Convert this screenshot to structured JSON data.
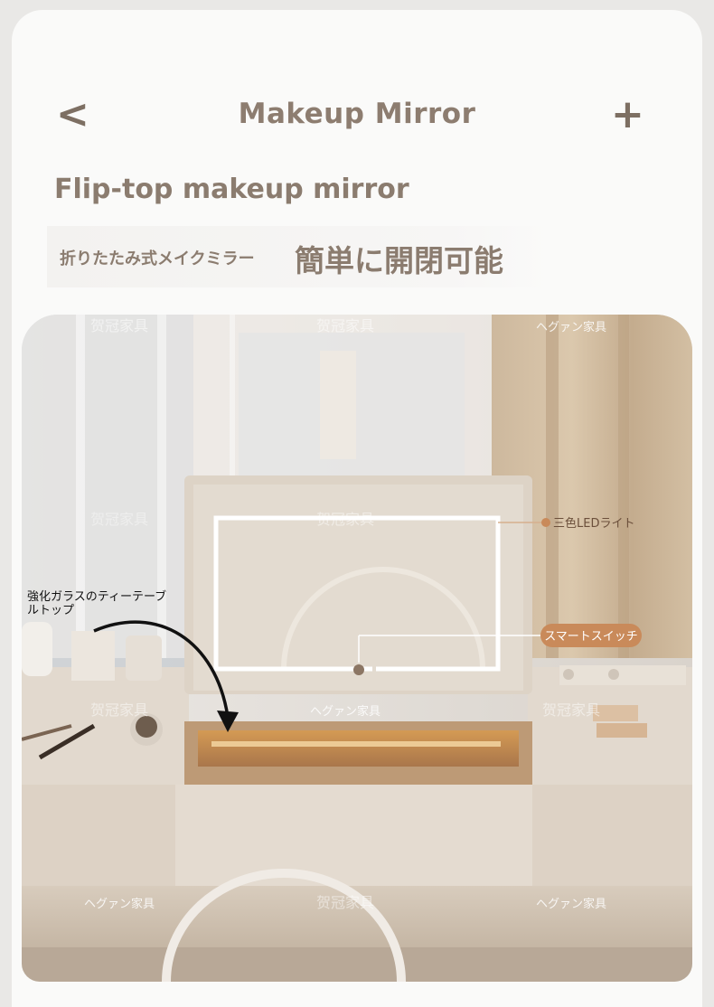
{
  "header": {
    "back_icon_glyph": "<",
    "title": "Makeup  Mirror",
    "plus_icon_glyph": "+"
  },
  "subtitle": "Flip-top  makeup  mirror",
  "tagline": {
    "small": "折りたたみ式メイクミラー",
    "big": "簡単に開閉可能"
  },
  "photo": {
    "annotations": {
      "glass_top": [
        "強化ガラスのティーテーブ",
        "ルトップ"
      ],
      "led_light": "三色LEDライト",
      "smart_switch": "スマートスイッチ"
    },
    "watermarks": {
      "hegvan": "ヘグァン家具",
      "heguan": "贺冠家具"
    }
  },
  "colors": {
    "accent": "#8b7c6f",
    "switch_badge": "#c98a5a",
    "page_background": "#fafaf9"
  }
}
